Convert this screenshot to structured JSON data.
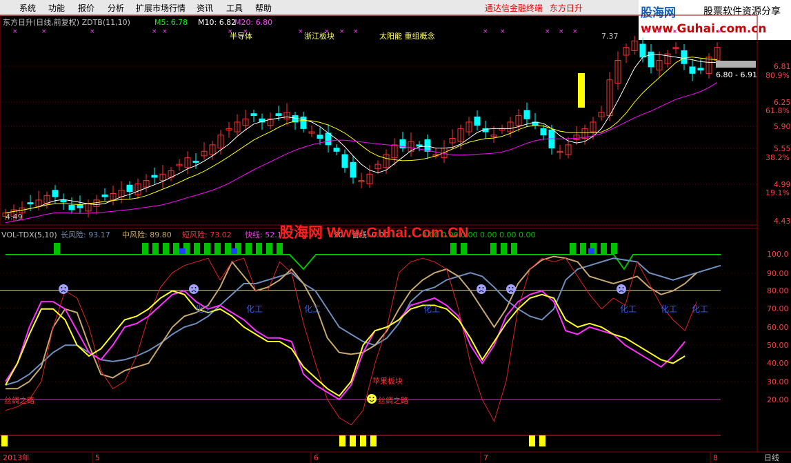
{
  "menu": [
    "系统",
    "功能",
    "报价",
    "分析",
    "扩展市场行情",
    "资讯",
    "工具",
    "帮助"
  ],
  "menu_right": [
    "通达信金融终端",
    "东方日升"
  ],
  "logo": {
    "cn": "股海网",
    "slogan": "股票软件资源分享",
    "url": "www.Guhai.com.cn"
  },
  "main_title": "东方日升(日线,前复权) ZDTB(11,10)",
  "ma_labels": [
    {
      "text": "M5: 6.78",
      "color": "#00ff00"
    },
    {
      "text": "M10: 6.82",
      "color": "#ffffff"
    },
    {
      "text": "M20: 6.80",
      "color": "#ff44ff"
    }
  ],
  "concept_labels": [
    "半导体",
    "浙江板块",
    "太阳能 重组概念"
  ],
  "price_axis": [
    "6.81",
    "80.9%",
    "6.25",
    "61.8%",
    "5.90",
    "5.55",
    "38.2%",
    "4.99",
    "19.1%",
    "4.43"
  ],
  "marks": {
    "high": "7.37",
    "low": "4.49",
    "range": "6.80 - 6.91"
  },
  "indicator": {
    "title": "VOL-TDX(5,10)",
    "long": "长风险: 93.17",
    "mid": "中风险: 89.80",
    "short": "短风险: 73.02",
    "fast": "快线: 52.1",
    "tail": ".50",
    "b1": "管线: 0.00",
    "b2": "0.00 0.00 0.00 0.00 0.00 0.00",
    "watermark": "股海网 Www.Guhai.Com.CN"
  },
  "ind_axis": [
    "100.0",
    "90.00",
    "80.00",
    "70.00",
    "60.00",
    "50.00",
    "40.00",
    "30.00",
    "20.00"
  ],
  "annotations": {
    "lower_left": "丝绸之路",
    "lower_mid": "丝绸之路",
    "mid": "苹果板块",
    "chem": "化工"
  },
  "bottom_axis": [
    "2013年",
    "5",
    "6",
    "7",
    "8"
  ],
  "period": "日线",
  "colors": {
    "up": "#ff3030",
    "down": "#00ffff",
    "ma5": "#ffffff",
    "ma10": "#ffff00",
    "ma20": "#ff00ff",
    "long": "#6e8ebe",
    "mid": "#c8a86e",
    "short": "#e02020",
    "fast": "#ffff20",
    "slow": "#ff30ff",
    "grid": "#8b0000",
    "green": "#00c000"
  }
}
